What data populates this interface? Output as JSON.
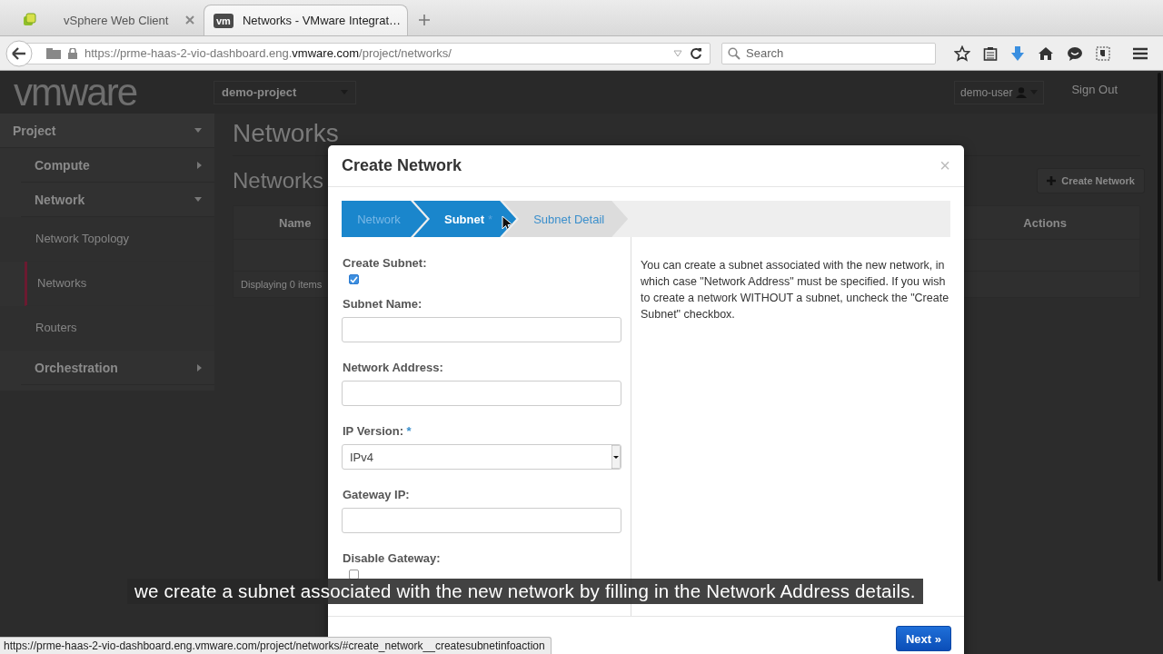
{
  "browser": {
    "tabs": [
      {
        "title": "vSphere Web Client",
        "selected": false
      },
      {
        "title": "Networks - VMware Integrat…",
        "selected": true,
        "favicon_text": "vm"
      }
    ],
    "url": {
      "prefix": "https://prme-haas-2-vio-dashboard.eng.",
      "domain": "vmware.com",
      "suffix": "/project/networks/"
    },
    "search": {
      "placeholder": "Search"
    }
  },
  "header": {
    "logo": "vmware",
    "project": "demo-project",
    "user": "demo-user",
    "sign_out": "Sign Out"
  },
  "sidebar": {
    "items": [
      {
        "label": "Project",
        "expanded": true,
        "children": [
          {
            "label": "Compute",
            "expanded": false
          },
          {
            "label": "Network",
            "expanded": true,
            "children": [
              {
                "label": "Network Topology",
                "selected": false
              },
              {
                "label": "Networks",
                "selected": true
              },
              {
                "label": "Routers",
                "selected": false
              }
            ]
          },
          {
            "label": "Orchestration",
            "expanded": false
          }
        ]
      }
    ]
  },
  "content": {
    "title": "Networks",
    "table_title": "Networks",
    "create_button": "Create Network",
    "table": {
      "columns": [
        "Name",
        "Actions"
      ]
    },
    "footer": "Displaying 0 items"
  },
  "modal": {
    "title": "Create Network",
    "close": "×",
    "steps": [
      {
        "label": "Network",
        "selected": false,
        "completed": true
      },
      {
        "label": "Subnet",
        "selected": true,
        "completed": false,
        "required_mark": "*"
      },
      {
        "label": "Subnet Detail",
        "selected": false,
        "completed": false
      }
    ],
    "fields": [
      {
        "kind": "checkbox",
        "label": "Create Subnet:",
        "checked": true
      },
      {
        "kind": "text",
        "label": "Subnet Name:"
      },
      {
        "kind": "text",
        "label": "Network Address:"
      },
      {
        "kind": "select",
        "label": "IP Version:",
        "required_mark": "*",
        "value": "IPv4"
      },
      {
        "kind": "text",
        "label": "Gateway IP:"
      },
      {
        "kind": "checkbox",
        "label": "Disable Gateway:",
        "checked": false
      }
    ],
    "help": "You can create a subnet associated with the new network, in which case \"Network Address\" must be specified. If you wish to create a network WITHOUT a subnet, uncheck the \"Create Subnet\" checkbox.",
    "next_button": "Next »"
  },
  "caption": "we create a subnet associated with the new network by filling in the Network Address details.",
  "status_url": "https://prme-haas-2-vio-dashboard.eng.vmware.com/project/networks/#create_network__createsubnetinfoaction"
}
